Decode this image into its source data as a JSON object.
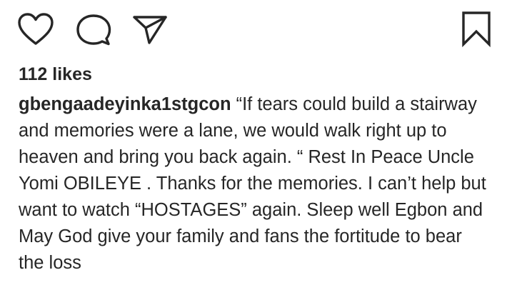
{
  "post": {
    "actions": {
      "like_icon": "heart-outline-icon",
      "comment_icon": "comment-bubble-icon",
      "share_icon": "paper-plane-icon",
      "save_icon": "bookmark-outline-icon"
    },
    "likes_text": "112 likes",
    "caption": {
      "username": "gbengaadeyinka1stgcon",
      "text": "“If tears could build a stairway and memories were a lane, we would walk right up to heaven and bring you back again. “ Rest In Peace Uncle Yomi OBILEYE . Thanks for the memories. I can’t help but want to watch “HOSTAGES” again. Sleep well Egbon and May God give your family and fans the fortitude to bear the loss"
    }
  },
  "colors": {
    "text": "#262626",
    "icon": "#262626",
    "background": "#ffffff"
  }
}
